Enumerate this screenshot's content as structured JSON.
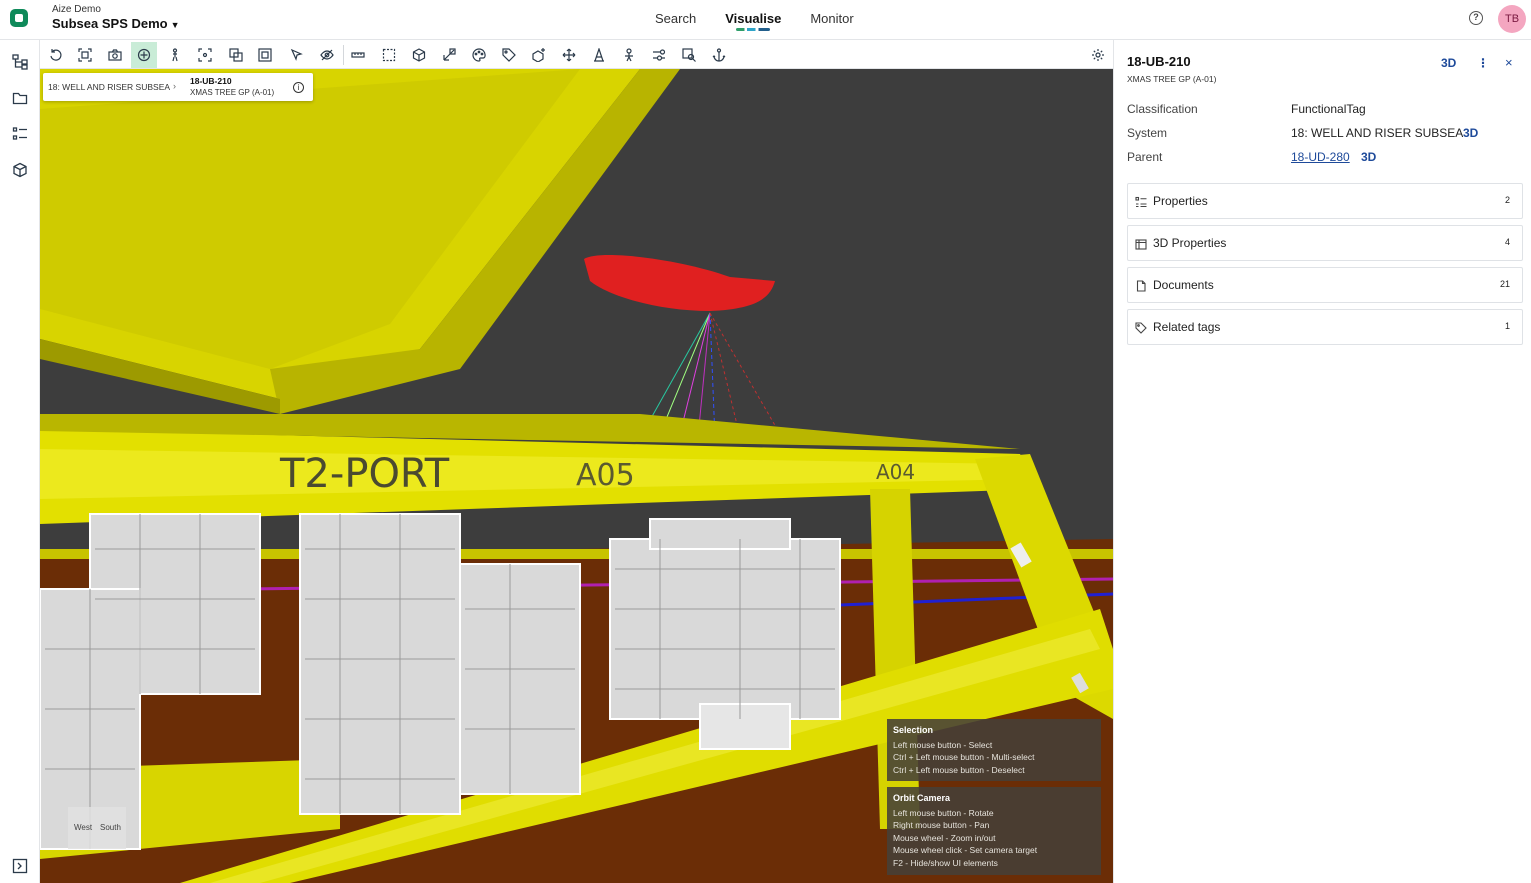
{
  "app": {
    "org": "Aize Demo",
    "project": "Subsea SPS Demo",
    "nav": [
      {
        "label": "Search"
      },
      {
        "label": "Visualise"
      },
      {
        "label": "Monitor"
      }
    ],
    "help_glyph": "?",
    "avatar_initials": "TB"
  },
  "viewport": {
    "breadcrumb": {
      "root": "18: WELL AND RISER SUBSEA",
      "arrow": "›",
      "tag": "18-UB-210",
      "description": "XMAS TREE GP (A-01)",
      "info_glyph": "i"
    },
    "scene_labels": [
      "T2-PORT",
      "A05",
      "A04"
    ],
    "compass": {
      "west": "West",
      "south": "South"
    },
    "hints": [
      {
        "title": "Selection",
        "lines": [
          "Left mouse button - Select",
          "Ctrl + Left mouse button - Multi-select",
          "Ctrl + Left mouse button - Deselect"
        ]
      },
      {
        "title": "Orbit Camera",
        "lines": [
          "Left mouse button - Rotate",
          "Right mouse button - Pan",
          "Mouse wheel - Zoom in/out",
          "Mouse wheel click - Set camera target",
          "F2 - Hide/show UI elements"
        ]
      }
    ]
  },
  "panel": {
    "title": "18-UB-210",
    "subtitle": "XMAS TREE GP (A-01)",
    "header_3d": "3D",
    "more_glyph": "⋮",
    "close_glyph": "×",
    "fields": {
      "classification_label": "Classification",
      "classification_value": "FunctionalTag",
      "system_label": "System",
      "system_value": "18: WELL AND RISER SUBSEA",
      "system_3d": "3D",
      "parent_label": "Parent",
      "parent_value": "18-UD-280",
      "parent_3d": "3D"
    },
    "sections": [
      {
        "label": "Properties",
        "count": "2",
        "icon": "list-icon"
      },
      {
        "label": "3D Properties",
        "count": "4",
        "icon": "cube-properties-icon"
      },
      {
        "label": "Documents",
        "count": "21",
        "icon": "document-icon"
      },
      {
        "label": "Related tags",
        "count": "1",
        "icon": "tag-icon"
      }
    ]
  },
  "colors": {
    "brand": "#0f8a5a",
    "accent_link": "#1e4a9a",
    "active_tool": "#c9ecd7",
    "structure_yellow": "#e3e000",
    "vessel_red": "#e02020",
    "seabed_brown": "#6b2d06"
  }
}
